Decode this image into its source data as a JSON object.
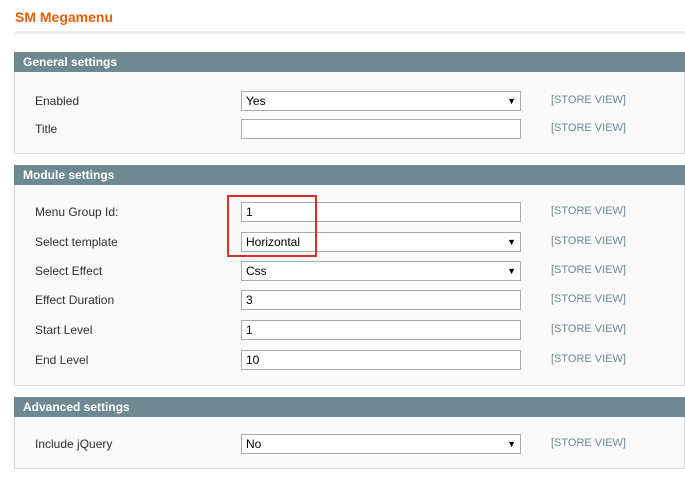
{
  "page": {
    "title": "SM Megamenu"
  },
  "colors": {
    "accent": "#eb5e00",
    "header_bg": "#6f8992",
    "highlight": "#d9302b"
  },
  "general": {
    "heading": "General settings",
    "enabled": {
      "label": "Enabled",
      "value": "Yes",
      "scope": "[STORE VIEW]"
    },
    "title": {
      "label": "Title",
      "value": "",
      "scope": "[STORE VIEW]"
    }
  },
  "module": {
    "heading": "Module settings",
    "menu_group_id": {
      "label": "Menu Group Id:",
      "value": "1",
      "scope": "[STORE VIEW]"
    },
    "select_template": {
      "label": "Select template",
      "value": "Horizontal",
      "scope": "[STORE VIEW]"
    },
    "select_effect": {
      "label": "Select Effect",
      "value": "Css",
      "scope": "[STORE VIEW]"
    },
    "effect_duration": {
      "label": "Effect Duration",
      "value": "3",
      "scope": "[STORE VIEW]"
    },
    "start_level": {
      "label": "Start Level",
      "value": "1",
      "scope": "[STORE VIEW]"
    },
    "end_level": {
      "label": "End Level",
      "value": "10",
      "scope": "[STORE VIEW]"
    }
  },
  "advanced": {
    "heading": "Advanced settings",
    "include_jquery": {
      "label": "Include jQuery",
      "value": "No",
      "scope": "[STORE VIEW]"
    }
  },
  "icons": {
    "dropdown": "chevron-down-icon"
  }
}
